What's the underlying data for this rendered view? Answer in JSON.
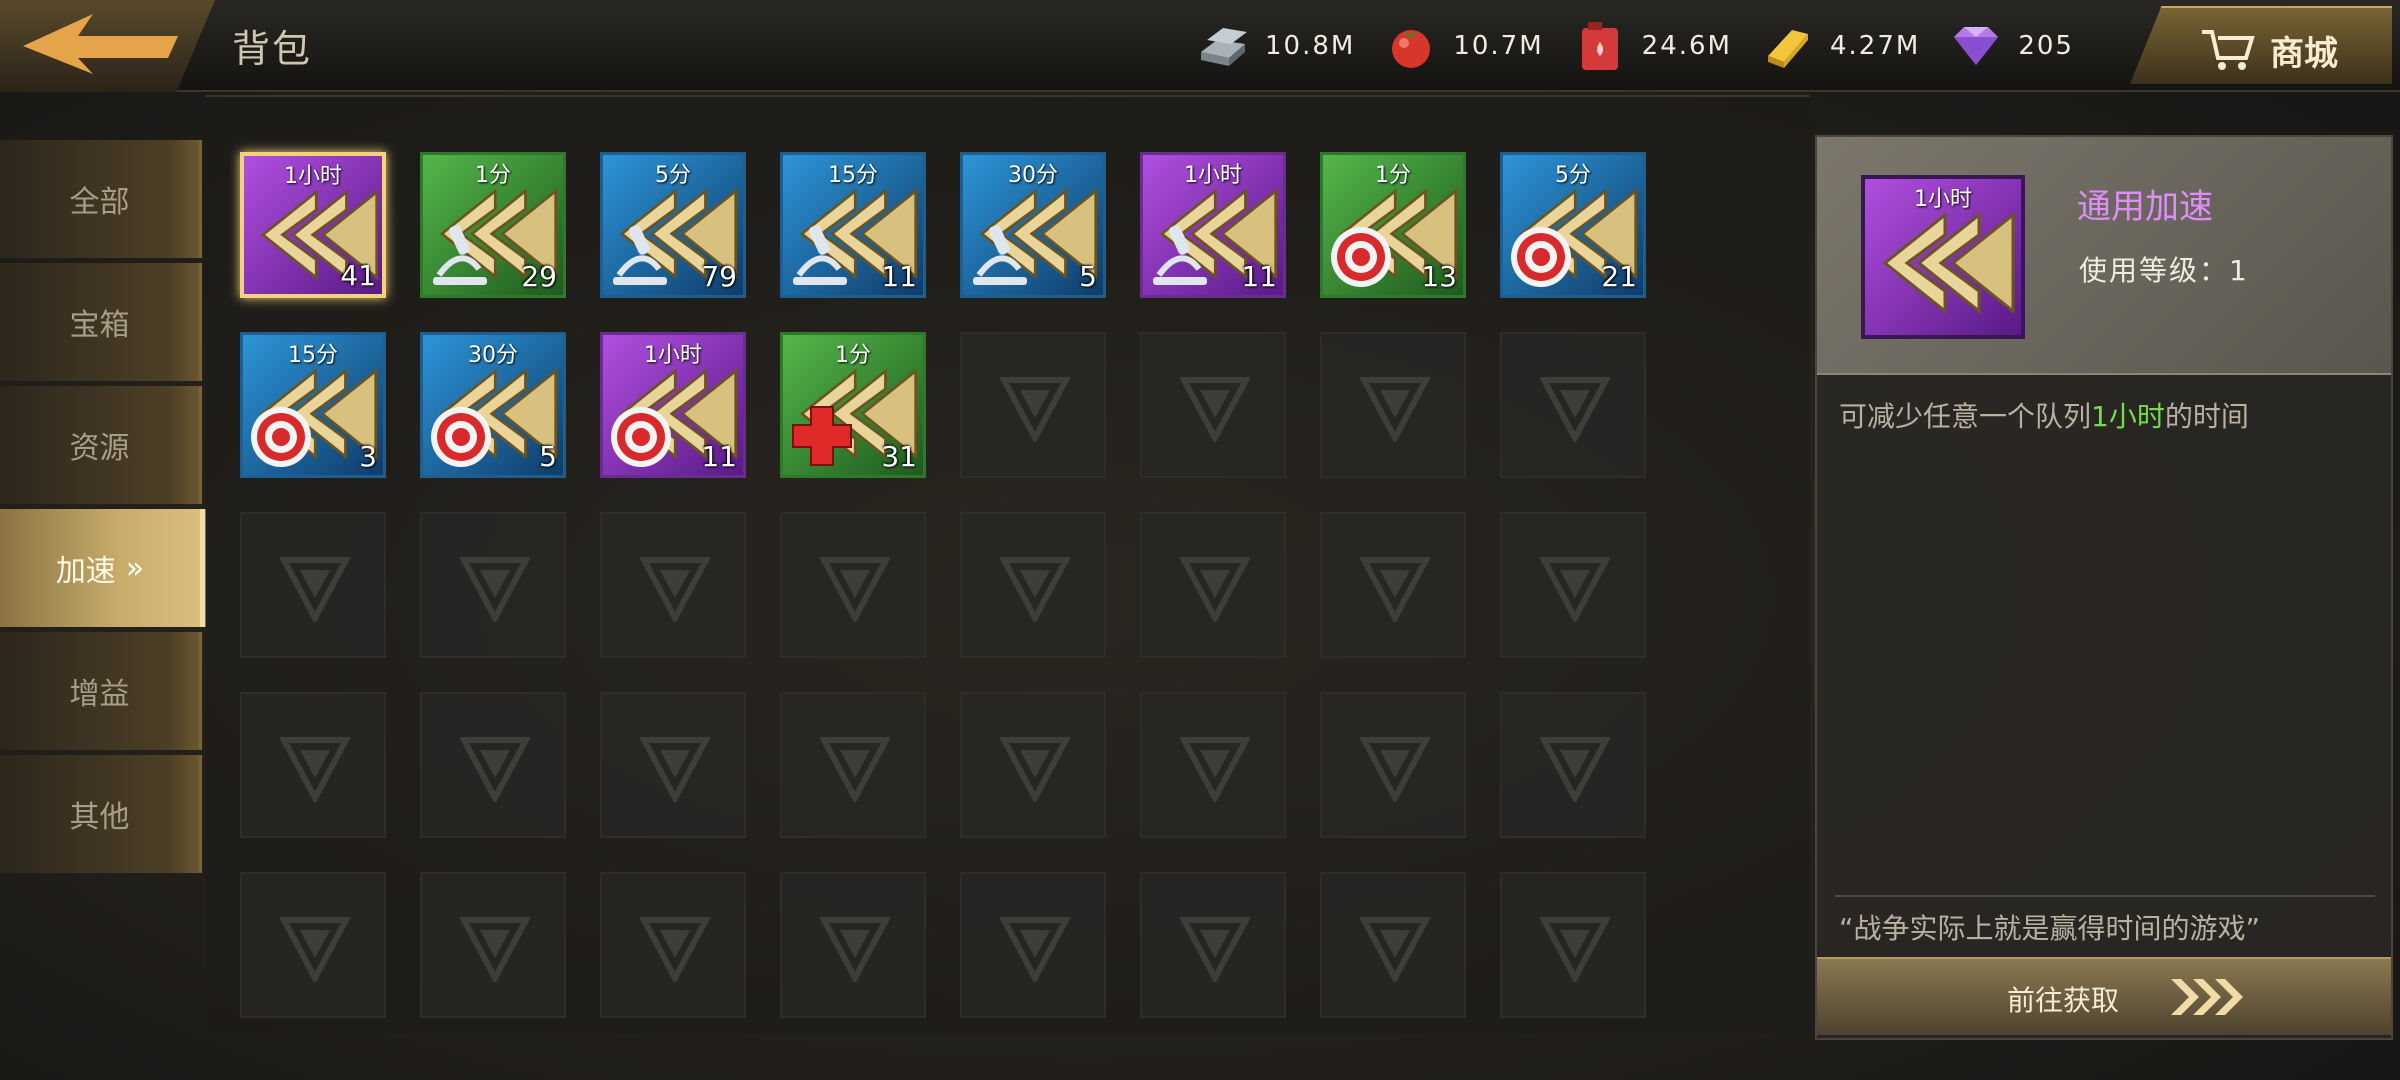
{
  "header": {
    "title": "背包",
    "shop_label": "商城"
  },
  "resources": [
    {
      "name": "steel",
      "icon": "steel-ingot-icon",
      "value": "10.8M"
    },
    {
      "name": "food",
      "icon": "tomato-icon",
      "value": "10.7M"
    },
    {
      "name": "oil",
      "icon": "oil-can-icon",
      "value": "24.6M"
    },
    {
      "name": "gold",
      "icon": "gold-bar-icon",
      "value": "4.27M"
    },
    {
      "name": "diamond",
      "icon": "diamond-icon",
      "value": "205"
    }
  ],
  "nav": [
    {
      "label": "全部",
      "active": false
    },
    {
      "label": "宝箱",
      "active": false
    },
    {
      "label": "资源",
      "active": false
    },
    {
      "label": "加速",
      "active": true
    },
    {
      "label": "增益",
      "active": false
    },
    {
      "label": "其他",
      "active": false
    }
  ],
  "items": [
    {
      "time": "1小时",
      "count": "41",
      "color": "purple",
      "sub": "none",
      "selected": true
    },
    {
      "time": "1分",
      "count": "29",
      "color": "green",
      "sub": "microscope",
      "selected": false
    },
    {
      "time": "5分",
      "count": "79",
      "color": "blue",
      "sub": "microscope",
      "selected": false
    },
    {
      "time": "15分",
      "count": "11",
      "color": "blue",
      "sub": "microscope",
      "selected": false
    },
    {
      "time": "30分",
      "count": "5",
      "color": "blue",
      "sub": "microscope",
      "selected": false
    },
    {
      "time": "1小时",
      "count": "11",
      "color": "purple",
      "sub": "microscope",
      "selected": false
    },
    {
      "time": "1分",
      "count": "13",
      "color": "green",
      "sub": "target",
      "selected": false
    },
    {
      "time": "5分",
      "count": "21",
      "color": "blue",
      "sub": "target",
      "selected": false
    },
    {
      "time": "15分",
      "count": "3",
      "color": "blue",
      "sub": "target",
      "selected": false
    },
    {
      "time": "30分",
      "count": "5",
      "color": "blue",
      "sub": "target",
      "selected": false
    },
    {
      "time": "1小时",
      "count": "11",
      "color": "purple",
      "sub": "target",
      "selected": false
    },
    {
      "time": "1分",
      "count": "31",
      "color": "green",
      "sub": "medical-cross",
      "selected": false
    }
  ],
  "detail": {
    "icon_time": "1小时",
    "name": "通用加速",
    "level": "使用等级：1",
    "desc_prefix": "可减少任意一个队列",
    "desc_highlight": "1小时",
    "desc_suffix": "的时间",
    "quote": "“战争实际上就是赢得时间的游戏”",
    "button_label": "前往获取"
  }
}
